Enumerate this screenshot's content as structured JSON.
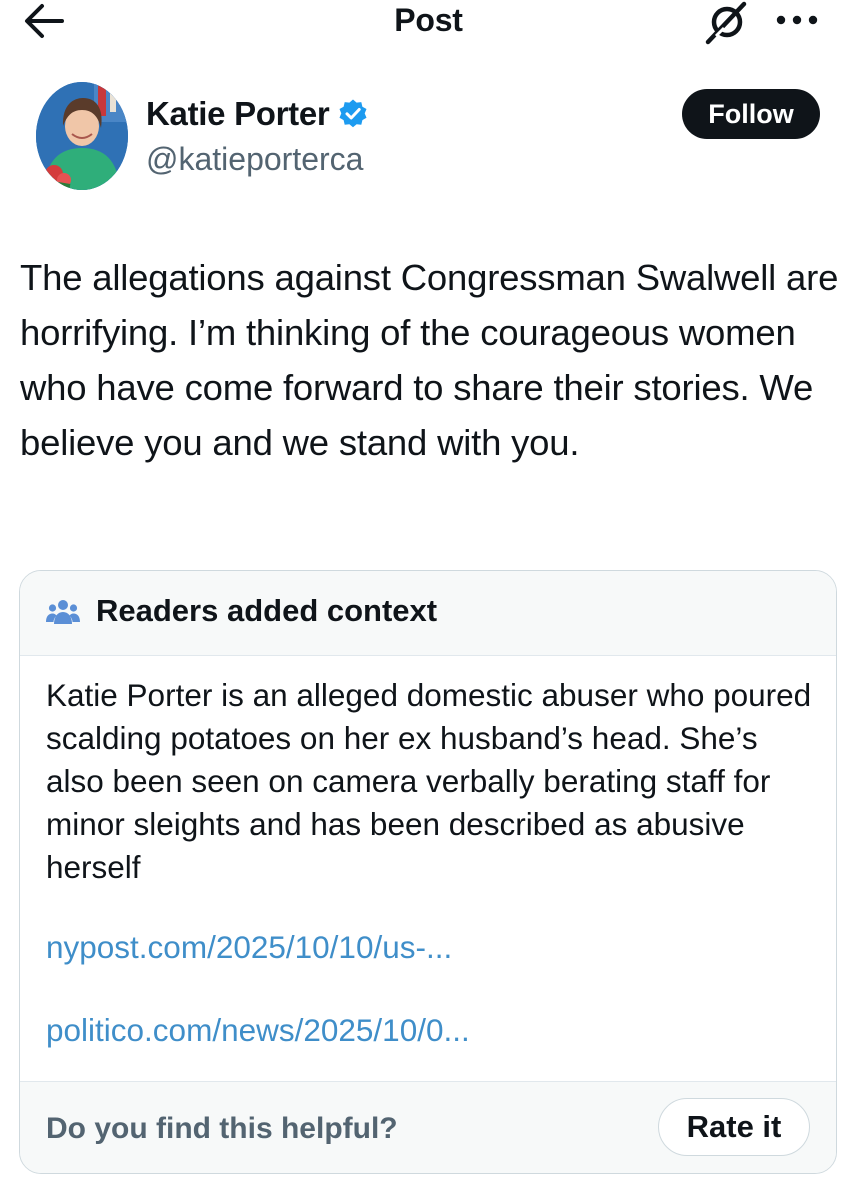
{
  "header": {
    "title": "Post",
    "back_icon": "arrow-left-icon",
    "grok_icon": "grok-icon",
    "more_icon": "more-horizontal-icon"
  },
  "author": {
    "name": "Katie Porter",
    "handle": "@katieporterca",
    "verified": true,
    "verified_color": "#1d9bf0",
    "follow_label": "Follow"
  },
  "post": {
    "text": "The allegations against Congressman Swalwell are horrifying. I’m thinking of the courageous women who have come forward to share their stories. We believe you and we stand with you."
  },
  "community_note": {
    "header_icon": "people-icon",
    "header_title": "Readers added context",
    "body": "Katie Porter is an alleged domestic abuser who poured scalding potatoes on her ex husband’s head. She’s also been seen on camera verbally berating staff for minor sleights and has been described as abusive herself",
    "links": [
      "nypost.com/2025/10/10/us-...",
      "politico.com/news/2025/10/0..."
    ],
    "helpful_question": "Do you find this helpful?",
    "rate_label": "Rate it"
  },
  "colors": {
    "text": "#0f1419",
    "secondary_text": "#536471",
    "link": "#3f8ec9",
    "follow_bg": "#0f1419",
    "card_border": "#cfd9de",
    "card_header_bg": "#f7f9f9"
  }
}
